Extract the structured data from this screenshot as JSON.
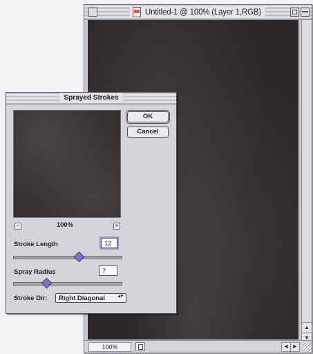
{
  "document_window": {
    "title": "Untitled-1 @ 100% (Layer 1,RGB)",
    "zoom_level": "100%"
  },
  "dialog": {
    "title": "Sprayed Strokes",
    "preview_zoom": "100%",
    "ok_label": "OK",
    "cancel_label": "Cancel",
    "stroke_length": {
      "label": "Stroke Length",
      "value": "12",
      "slider_fraction": 0.6
    },
    "spray_radius": {
      "label": "Spray Radius",
      "value": "7",
      "slider_fraction": 0.3
    },
    "stroke_dir": {
      "label": "Stroke Dir:",
      "selected": "Right Diagonal"
    }
  },
  "icons": {
    "zoom_out": "−",
    "zoom_in": "+",
    "scroll_up": "▲",
    "scroll_down": "▼",
    "scroll_left": "◀",
    "scroll_right": "▶",
    "select_arrows": "▴▾"
  }
}
